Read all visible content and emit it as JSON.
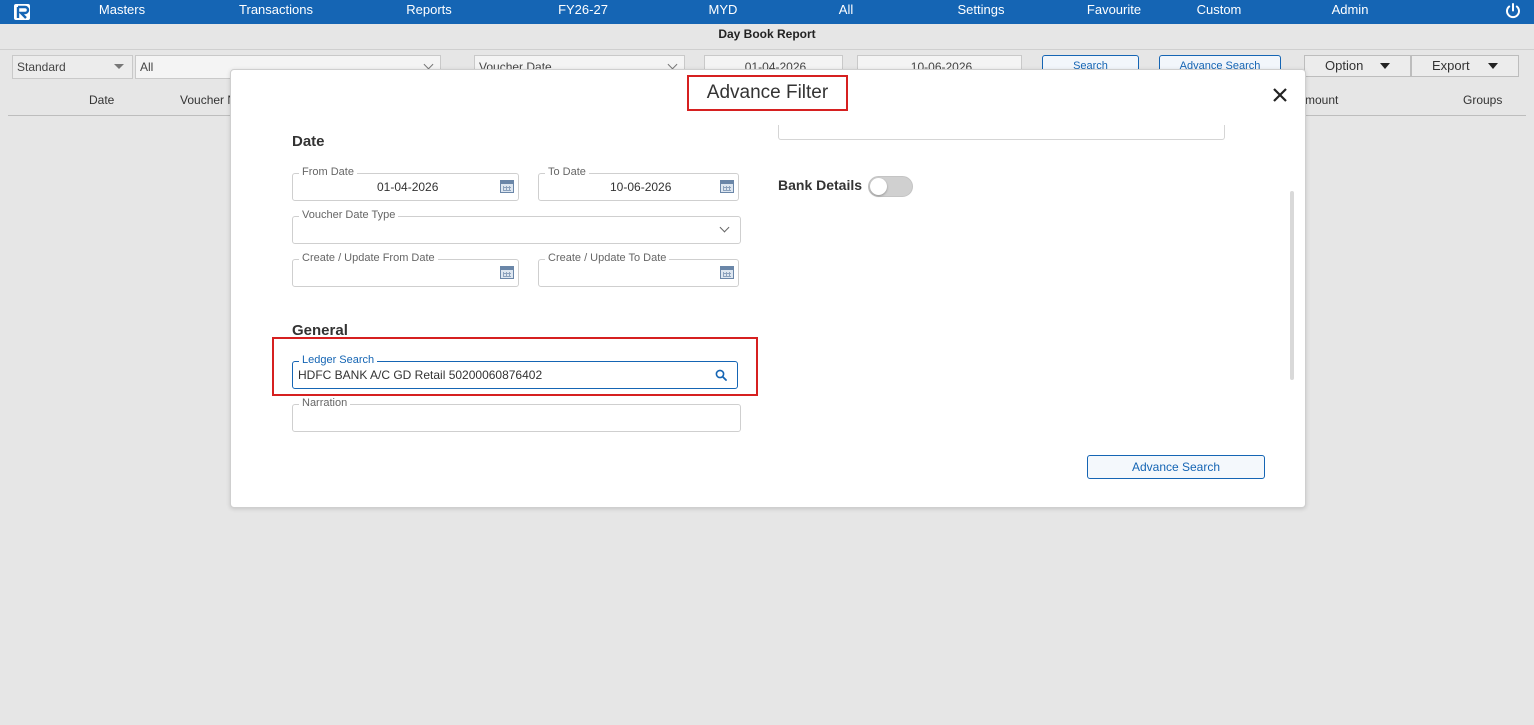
{
  "nav": {
    "items": [
      "Masters",
      "Transactions",
      "Reports",
      "FY26-27",
      "MYD",
      "All",
      "Settings",
      "Favourite",
      "Custom",
      "Admin"
    ]
  },
  "report_title": "Day Book Report",
  "filters": {
    "view_select": "Standard",
    "scope_select": "All",
    "date_type_select": "Voucher Date",
    "from_date": "01-04-2026",
    "to_date": "10-06-2026",
    "search_button": "Search",
    "advance_search_button": "Advance Search",
    "option_button": "Option",
    "export_button": "Export"
  },
  "columns": {
    "date": "Date",
    "voucher": "Voucher N",
    "amount": "mount",
    "groups": "Groups"
  },
  "modal": {
    "title": "Advance Filter",
    "date_section": "Date",
    "from_date_label": "From Date",
    "from_date_value": "01-04-2026",
    "to_date_label": "To Date",
    "to_date_value": "10-06-2026",
    "voucher_date_type_label": "Voucher Date Type",
    "voucher_date_type_value": "",
    "create_update_from_label": "Create / Update From Date",
    "create_update_to_label": "Create / Update To Date",
    "general_section": "General",
    "ledger_search_label": "Ledger Search",
    "ledger_search_value": "HDFC BANK A/C GD Retail 50200060876402",
    "narration_label": "Narration",
    "narration_value": "",
    "bank_details_label": "Bank Details",
    "bank_details_on": false,
    "advance_search_button": "Advance Search"
  },
  "colors": {
    "nav_bg": "#1565b4",
    "accent": "#1565b4",
    "highlight": "#d62020"
  }
}
